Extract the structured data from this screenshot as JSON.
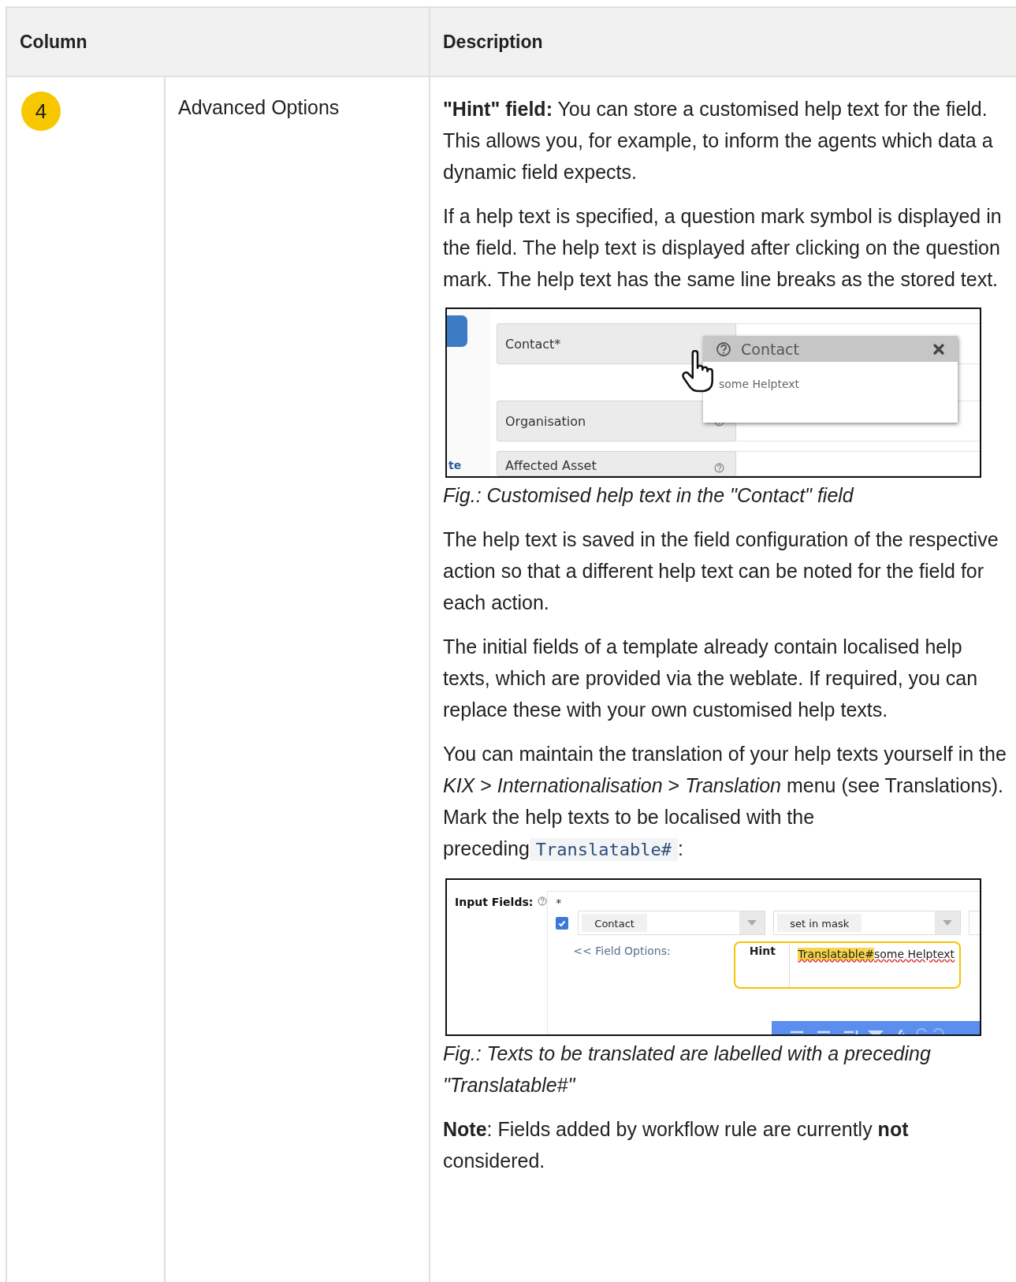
{
  "table": {
    "columns": [
      "Column",
      "Description"
    ],
    "rows": [
      {
        "badge": "4",
        "name": "Advanced Options",
        "description": [
          {
            "kind": "paragraph",
            "text": "**\"Hint\" field:** You can store a customised help text for the field. This allows you, for example, to inform the agents which data a dynamic field expects."
          },
          {
            "kind": "paragraph",
            "text": "If a help text is specified, a question mark symbol is displayed in the field. The help text is displayed after clicking on the question mark. The help text has the same line breaks as the stored text."
          },
          {
            "kind": "help_popup_figure",
            "side_label": "te",
            "fields": [
              "Contact*",
              "Organisation",
              "Affected Asset"
            ],
            "popup_title": "Contact",
            "popup_text": "some Helptext"
          },
          {
            "kind": "caption",
            "text": "Fig.: Customised help text in the \"Contact\" field"
          },
          {
            "kind": "paragraph",
            "text": "The help text is saved in the field configuration of the respective action so that a different help text can be noted for the field for each action."
          },
          {
            "kind": "paragraph",
            "text": "The initial fields of a template already contain localised help texts, which are provided via the weblate. If required, you can replace these with your own customised help texts."
          },
          {
            "kind": "code_paragraph",
            "text": "You can maintain the translation of your help texts yourself in the *KIX* > *Internationalisation* > *Translation* menu (see Translations). Mark the help texts to be localised with the preceding",
            "code": "Translatable#",
            "after": ":"
          },
          {
            "kind": "field_options_figure",
            "label": "Input Fields:",
            "required_mark": "*",
            "checked": true,
            "selects": [
              "Contact",
              "set in mask"
            ],
            "options_link": "<< Field Options:",
            "hint_label": "Hint",
            "hint_highlight": "Translatable#",
            "hint_rest": "some Helptext"
          },
          {
            "kind": "caption",
            "text": "Fig.: Texts to be translated are labelled with a preceding \"Translatable#\""
          },
          {
            "kind": "paragraph",
            "text": "**Note**: Fields added by workflow rule are currently **not** considered."
          }
        ]
      }
    ]
  }
}
